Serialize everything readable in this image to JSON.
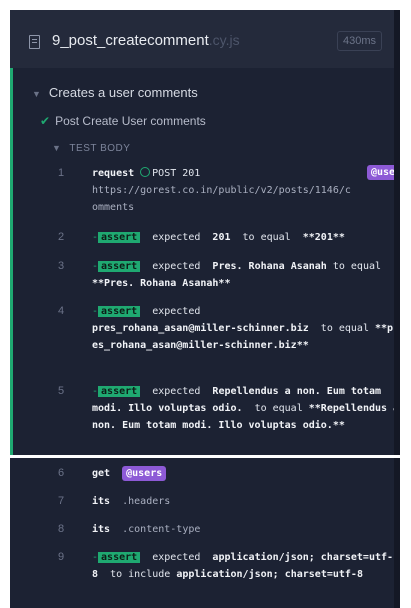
{
  "header": {
    "spec_name": "9_post_createcomment",
    "spec_ext": ".cy.js",
    "duration": "430ms"
  },
  "suite": {
    "title": "Creates a user comments"
  },
  "test": {
    "title": "Post Create User comments",
    "body_label": "TEST BODY"
  },
  "commands": [
    {
      "num": "1",
      "name": "request",
      "method": "POST 201",
      "url": "https://gorest.co.in/public/v2/posts/1146/comments",
      "alias": "@users"
    },
    {
      "num": "2",
      "badge": "assert",
      "text1": "expected",
      "value1": "201",
      "text2": "to equal",
      "value2": "**201**"
    },
    {
      "num": "3",
      "badge": "assert",
      "text1": "expected",
      "value1": "Pres. Rohana Asanah",
      "text2": "to equal",
      "value2": "**Pres. Rohana Asanah**"
    },
    {
      "num": "4",
      "badge": "assert",
      "text1": "expected",
      "value1": "pres_rohana_asan@miller-schinner.biz",
      "text2": "to equal",
      "value2": "**pres_rohana_asan@miller-schinner.biz**"
    },
    {
      "num": "5",
      "badge": "assert",
      "text1": "expected",
      "value1": "Repellendus a non. Eum totam modi. Illo voluptas odio.",
      "text2": "to equal",
      "value2": "**Repellendus a non. Eum totam modi. Illo voluptas odio.**"
    },
    {
      "num": "6",
      "name": "get",
      "alias": "@users"
    },
    {
      "num": "7",
      "name": "its",
      "arg": ".headers"
    },
    {
      "num": "8",
      "name": "its",
      "arg": ".content-type"
    },
    {
      "num": "9",
      "badge": "assert",
      "text1": "expected",
      "value1": "application/json; charset=utf-8",
      "text2": "to include",
      "value2": "application/json; charset=utf-8"
    }
  ],
  "colors": {
    "panel": "#1c2233",
    "pass_green": "#1fa971",
    "alias_purple": "#8d5ad6"
  },
  "icons": [
    "file-icon",
    "caret-down-icon",
    "check-icon",
    "circle-icon"
  ]
}
